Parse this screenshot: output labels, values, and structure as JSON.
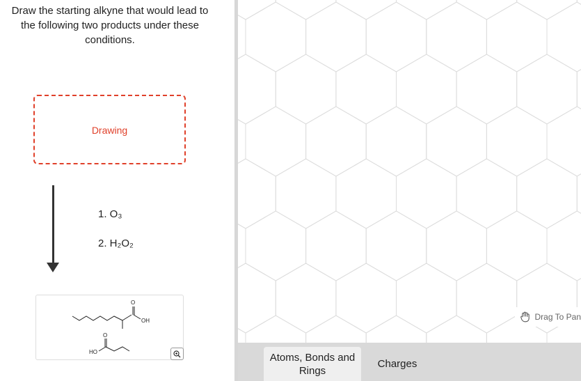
{
  "question": {
    "text": "Draw the starting alkyne that would lead to the following two products under these conditions."
  },
  "drawing_box": {
    "label": "Drawing"
  },
  "conditions": {
    "step1": "1. O₃",
    "step2": "2. H₂O₂"
  },
  "products": {
    "labels": {
      "oh": "OH",
      "ho": "HO",
      "o_top": "O",
      "o_bottom": "O"
    }
  },
  "canvas": {
    "drag_to_pan": "Drag To Pan"
  },
  "toolbar": {
    "tab_atoms": "Atoms, Bonds and Rings",
    "tab_charges": "Charges"
  },
  "colors": {
    "accent_red": "#e0402a",
    "hex_grid": "#dcdcdc",
    "toolbar_bg": "#d9d9d9"
  },
  "icons": {
    "zoom": "zoom-in-icon",
    "pan": "hand-icon"
  }
}
